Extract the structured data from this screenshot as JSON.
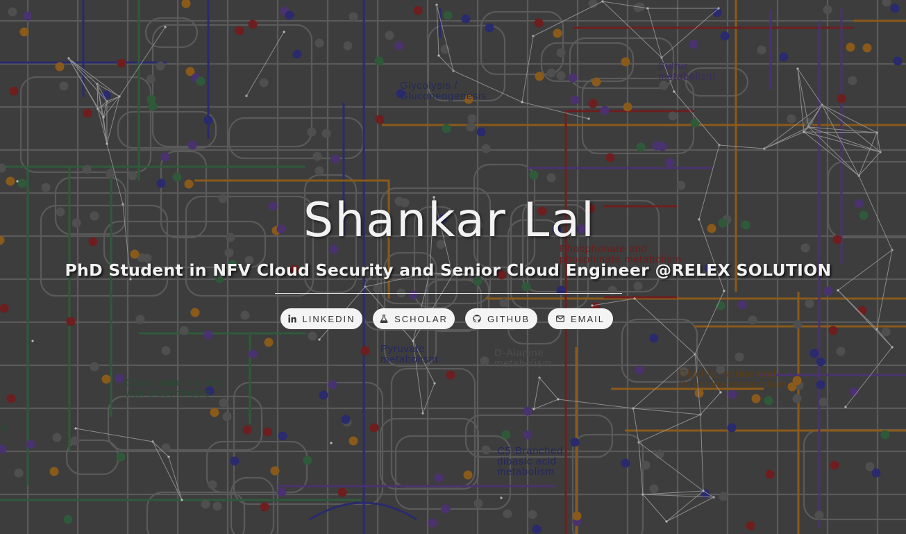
{
  "hero": {
    "name": "Shankar Lal",
    "subtitle": "PhD Student in NFV Cloud Security and Senior Cloud Engineer @RELEX SOLUTION"
  },
  "links": [
    {
      "label": "LINKEDIN",
      "icon": "linkedin-icon"
    },
    {
      "label": "SCHOLAR",
      "icon": "flask-icon"
    },
    {
      "label": "GITHUB",
      "icon": "github-icon"
    },
    {
      "label": "EMAIL",
      "icon": "envelope-icon"
    }
  ],
  "background_labels": {
    "glycolysis": "Glycolysis /\nGluconeogenesis",
    "sulfur": "Sulfur\nmetabolism",
    "phosphonate": "Phosphonate and\nphosphinate metabolism",
    "pyruvate": "Pyruvate\nmetabolism",
    "d_alanine": "D-Alanine\nmetabolism",
    "glycine": "Glycine, serine and\nthreonine metabolism",
    "cutin": "Cutin, suberine and\nwax biosynthesis",
    "c5": "C5-Branched\ndibasic acid\nmetabolism",
    "edge": "m"
  },
  "colors": {
    "page_background": "#3d3d3d",
    "grid_lines": "#5c5c5c",
    "pathway_navy": "#2a2a6e",
    "pathway_green": "#2f5a3a",
    "pathway_orange": "#8a5a1a",
    "pathway_red": "#6e1e1e",
    "pathway_purple": "#4a3270",
    "button_background": "#f4f4f4",
    "hero_text": "#f2f2f2"
  }
}
